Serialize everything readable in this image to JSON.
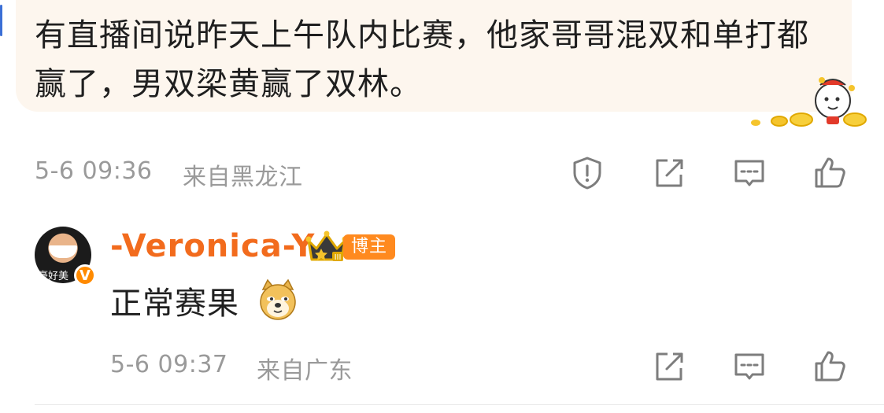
{
  "comment": {
    "text": "有直播间说昨天上午队内比赛，他家哥哥混双和单打都赢了，男双梁黄赢了双林。",
    "timestamp": "5-6 09:36",
    "location": "来自黑龙江"
  },
  "reply": {
    "username": "-Veronica-Y",
    "badge_label": "博主",
    "badge_level": "III",
    "avatar_caption": "豪好美",
    "verified_mark": "V",
    "text": "正常赛果",
    "emoji": "doge-emoji",
    "timestamp": "5-6 09:37",
    "location": "来自广东"
  },
  "icons": {
    "report": "shield-alert-icon",
    "share": "share-external-icon",
    "comment": "comment-bubble-icon",
    "like": "thumbs-up-icon"
  },
  "colors": {
    "bubble_bg": "#fdf6ee",
    "username": "#f26b1d",
    "meta_text": "#9a9a9a",
    "icon_stroke": "#7d7d7d",
    "badge": "#ff8a1f"
  }
}
